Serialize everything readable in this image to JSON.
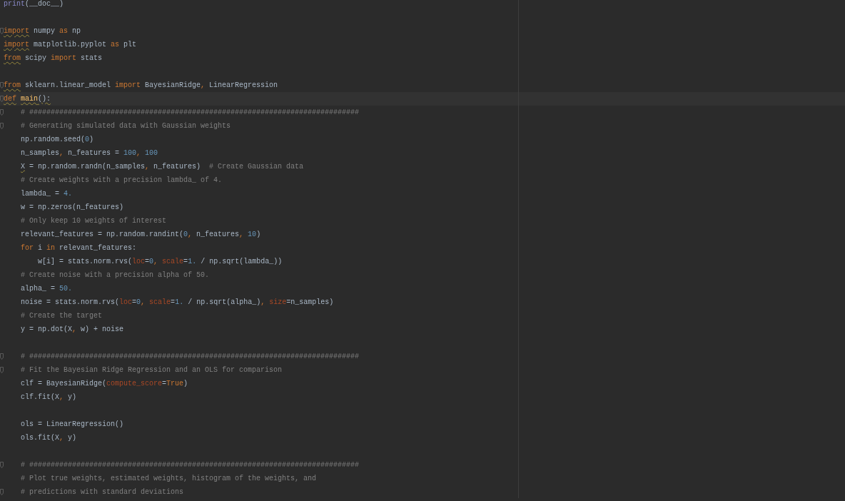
{
  "editor": {
    "lines": [
      {
        "fold": false,
        "current": false,
        "tokens": [
          {
            "kind": "builtin",
            "text": "print"
          },
          {
            "kind": "plain",
            "text": "(__doc__)"
          }
        ]
      },
      {
        "fold": false
      },
      {
        "fold": true,
        "current": false,
        "tokens": [
          {
            "kind": "keyword",
            "text": "import",
            "warn": true
          },
          {
            "kind": "plain",
            "text": " numpy "
          },
          {
            "kind": "keyword",
            "text": "as"
          },
          {
            "kind": "plain",
            "text": " np"
          }
        ]
      },
      {
        "fold": false,
        "current": false,
        "tokens": [
          {
            "kind": "keyword",
            "text": "import",
            "warn": true
          },
          {
            "kind": "plain",
            "text": " matplotlib.pyplot "
          },
          {
            "kind": "keyword",
            "text": "as"
          },
          {
            "kind": "plain",
            "text": " plt"
          }
        ]
      },
      {
        "fold": false,
        "current": false,
        "tokens": [
          {
            "kind": "keyword",
            "text": "from",
            "warn": true
          },
          {
            "kind": "plain",
            "text": " scipy "
          },
          {
            "kind": "keyword",
            "text": "import"
          },
          {
            "kind": "plain",
            "text": " stats"
          }
        ]
      },
      {
        "fold": false
      },
      {
        "fold": true,
        "current": false,
        "tokens": [
          {
            "kind": "keyword",
            "text": "from",
            "warn": true
          },
          {
            "kind": "plain",
            "text": " sklearn.linear_model "
          },
          {
            "kind": "keyword",
            "text": "import"
          },
          {
            "kind": "plain",
            "text": " BayesianRidge"
          },
          {
            "kind": "sep",
            "text": ", "
          },
          {
            "kind": "plain",
            "text": "LinearRegression"
          }
        ]
      },
      {
        "fold": true,
        "current": true,
        "tokens": [
          {
            "kind": "keyword",
            "text": "def",
            "warn": true
          },
          {
            "kind": "funcname",
            "text": " main",
            "warn": true
          },
          {
            "kind": "plain",
            "text": "():",
            "warn": true
          }
        ]
      },
      {
        "fold": true,
        "current": false,
        "tokens": [
          {
            "kind": "comment",
            "text": "    # #############################################################################"
          }
        ]
      },
      {
        "fold": true,
        "current": false,
        "tokens": [
          {
            "kind": "comment",
            "text": "    # Generating simulated data with Gaussian weights"
          }
        ]
      },
      {
        "fold": false,
        "current": false,
        "tokens": [
          {
            "kind": "plain",
            "text": "    np.random.seed("
          },
          {
            "kind": "number",
            "text": "0"
          },
          {
            "kind": "plain",
            "text": ")"
          }
        ]
      },
      {
        "fold": false,
        "current": false,
        "tokens": [
          {
            "kind": "plain",
            "text": "    n_samples"
          },
          {
            "kind": "sep",
            "text": ", "
          },
          {
            "kind": "plain",
            "text": "n_features = "
          },
          {
            "kind": "number",
            "text": "100"
          },
          {
            "kind": "sep",
            "text": ", "
          },
          {
            "kind": "number",
            "text": "100"
          }
        ]
      },
      {
        "fold": false,
        "current": false,
        "tokens": [
          {
            "kind": "plain",
            "text": "    X",
            "warn": true
          },
          {
            "kind": "plain",
            "text": " = np.random.randn(n_samples"
          },
          {
            "kind": "sep",
            "text": ", "
          },
          {
            "kind": "plain",
            "text": "n_features)  "
          },
          {
            "kind": "comment",
            "text": "# Create Gaussian data"
          }
        ]
      },
      {
        "fold": false,
        "current": false,
        "tokens": [
          {
            "kind": "comment",
            "text": "    # Create weights with a precision lambda_ of 4."
          }
        ]
      },
      {
        "fold": false,
        "current": false,
        "tokens": [
          {
            "kind": "plain",
            "text": "    lambda_ = "
          },
          {
            "kind": "number",
            "text": "4."
          }
        ]
      },
      {
        "fold": false,
        "current": false,
        "tokens": [
          {
            "kind": "plain",
            "text": "    w = np.zeros(n_features)"
          }
        ]
      },
      {
        "fold": false,
        "current": false,
        "tokens": [
          {
            "kind": "comment",
            "text": "    # Only keep 10 weights of interest"
          }
        ]
      },
      {
        "fold": false,
        "current": false,
        "tokens": [
          {
            "kind": "plain",
            "text": "    relevant_features = np.random.randint("
          },
          {
            "kind": "number",
            "text": "0"
          },
          {
            "kind": "sep",
            "text": ", "
          },
          {
            "kind": "plain",
            "text": "n_features"
          },
          {
            "kind": "sep",
            "text": ", "
          },
          {
            "kind": "number",
            "text": "10"
          },
          {
            "kind": "plain",
            "text": ")"
          }
        ]
      },
      {
        "fold": false,
        "current": false,
        "tokens": [
          {
            "kind": "keyword",
            "text": "    for"
          },
          {
            "kind": "plain",
            "text": " i "
          },
          {
            "kind": "keyword",
            "text": "in"
          },
          {
            "kind": "plain",
            "text": " relevant_features:"
          }
        ]
      },
      {
        "fold": false,
        "current": false,
        "tokens": [
          {
            "kind": "plain",
            "text": "        w[i] = stats.norm.rvs("
          },
          {
            "kind": "param",
            "text": "loc"
          },
          {
            "kind": "plain",
            "text": "="
          },
          {
            "kind": "number",
            "text": "0"
          },
          {
            "kind": "sep",
            "text": ", "
          },
          {
            "kind": "param",
            "text": "scale"
          },
          {
            "kind": "plain",
            "text": "="
          },
          {
            "kind": "number",
            "text": "1."
          },
          {
            "kind": "plain",
            "text": " / np.sqrt(lambda_))"
          }
        ]
      },
      {
        "fold": false,
        "current": false,
        "tokens": [
          {
            "kind": "comment",
            "text": "    # Create noise with a precision alpha of 50."
          }
        ]
      },
      {
        "fold": false,
        "current": false,
        "tokens": [
          {
            "kind": "plain",
            "text": "    alpha_ = "
          },
          {
            "kind": "number",
            "text": "50."
          }
        ]
      },
      {
        "fold": false,
        "current": false,
        "tokens": [
          {
            "kind": "plain",
            "text": "    noise = stats.norm.rvs("
          },
          {
            "kind": "param",
            "text": "loc"
          },
          {
            "kind": "plain",
            "text": "="
          },
          {
            "kind": "number",
            "text": "0"
          },
          {
            "kind": "sep",
            "text": ", "
          },
          {
            "kind": "param",
            "text": "scale"
          },
          {
            "kind": "plain",
            "text": "="
          },
          {
            "kind": "number",
            "text": "1."
          },
          {
            "kind": "plain",
            "text": " / np.sqrt(alpha_)"
          },
          {
            "kind": "sep",
            "text": ", "
          },
          {
            "kind": "param",
            "text": "size"
          },
          {
            "kind": "plain",
            "text": "=n_samples)"
          }
        ]
      },
      {
        "fold": false,
        "current": false,
        "tokens": [
          {
            "kind": "comment",
            "text": "    # Create the target"
          }
        ]
      },
      {
        "fold": false,
        "current": false,
        "tokens": [
          {
            "kind": "plain",
            "text": "    y = np.dot(X"
          },
          {
            "kind": "sep",
            "text": ", "
          },
          {
            "kind": "plain",
            "text": "w) + noise"
          }
        ]
      },
      {
        "fold": false
      },
      {
        "fold": true,
        "current": false,
        "tokens": [
          {
            "kind": "comment",
            "text": "    # #############################################################################"
          }
        ]
      },
      {
        "fold": true,
        "current": false,
        "tokens": [
          {
            "kind": "comment",
            "text": "    # Fit the Bayesian Ridge Regression and an OLS for comparison"
          }
        ]
      },
      {
        "fold": false,
        "current": false,
        "tokens": [
          {
            "kind": "plain",
            "text": "    clf = BayesianRidge("
          },
          {
            "kind": "param",
            "text": "compute_score"
          },
          {
            "kind": "plain",
            "text": "="
          },
          {
            "kind": "keyword",
            "text": "True"
          },
          {
            "kind": "plain",
            "text": ")"
          }
        ]
      },
      {
        "fold": false,
        "current": false,
        "tokens": [
          {
            "kind": "plain",
            "text": "    clf.fit(X"
          },
          {
            "kind": "sep",
            "text": ", "
          },
          {
            "kind": "plain",
            "text": "y)"
          }
        ]
      },
      {
        "fold": false
      },
      {
        "fold": false,
        "current": false,
        "tokens": [
          {
            "kind": "plain",
            "text": "    ols = LinearRegression()"
          }
        ]
      },
      {
        "fold": false,
        "current": false,
        "tokens": [
          {
            "kind": "plain",
            "text": "    ols.fit(X"
          },
          {
            "kind": "sep",
            "text": ", "
          },
          {
            "kind": "plain",
            "text": "y)"
          }
        ]
      },
      {
        "fold": false
      },
      {
        "fold": true,
        "current": false,
        "tokens": [
          {
            "kind": "comment",
            "text": "    # #############################################################################"
          }
        ]
      },
      {
        "fold": false,
        "current": false,
        "tokens": [
          {
            "kind": "comment",
            "text": "    # Plot true weights, estimated weights, histogram of the weights, and"
          }
        ]
      },
      {
        "fold": true,
        "current": false,
        "tokens": [
          {
            "kind": "comment",
            "text": "    # predictions with standard deviations"
          }
        ]
      }
    ]
  }
}
